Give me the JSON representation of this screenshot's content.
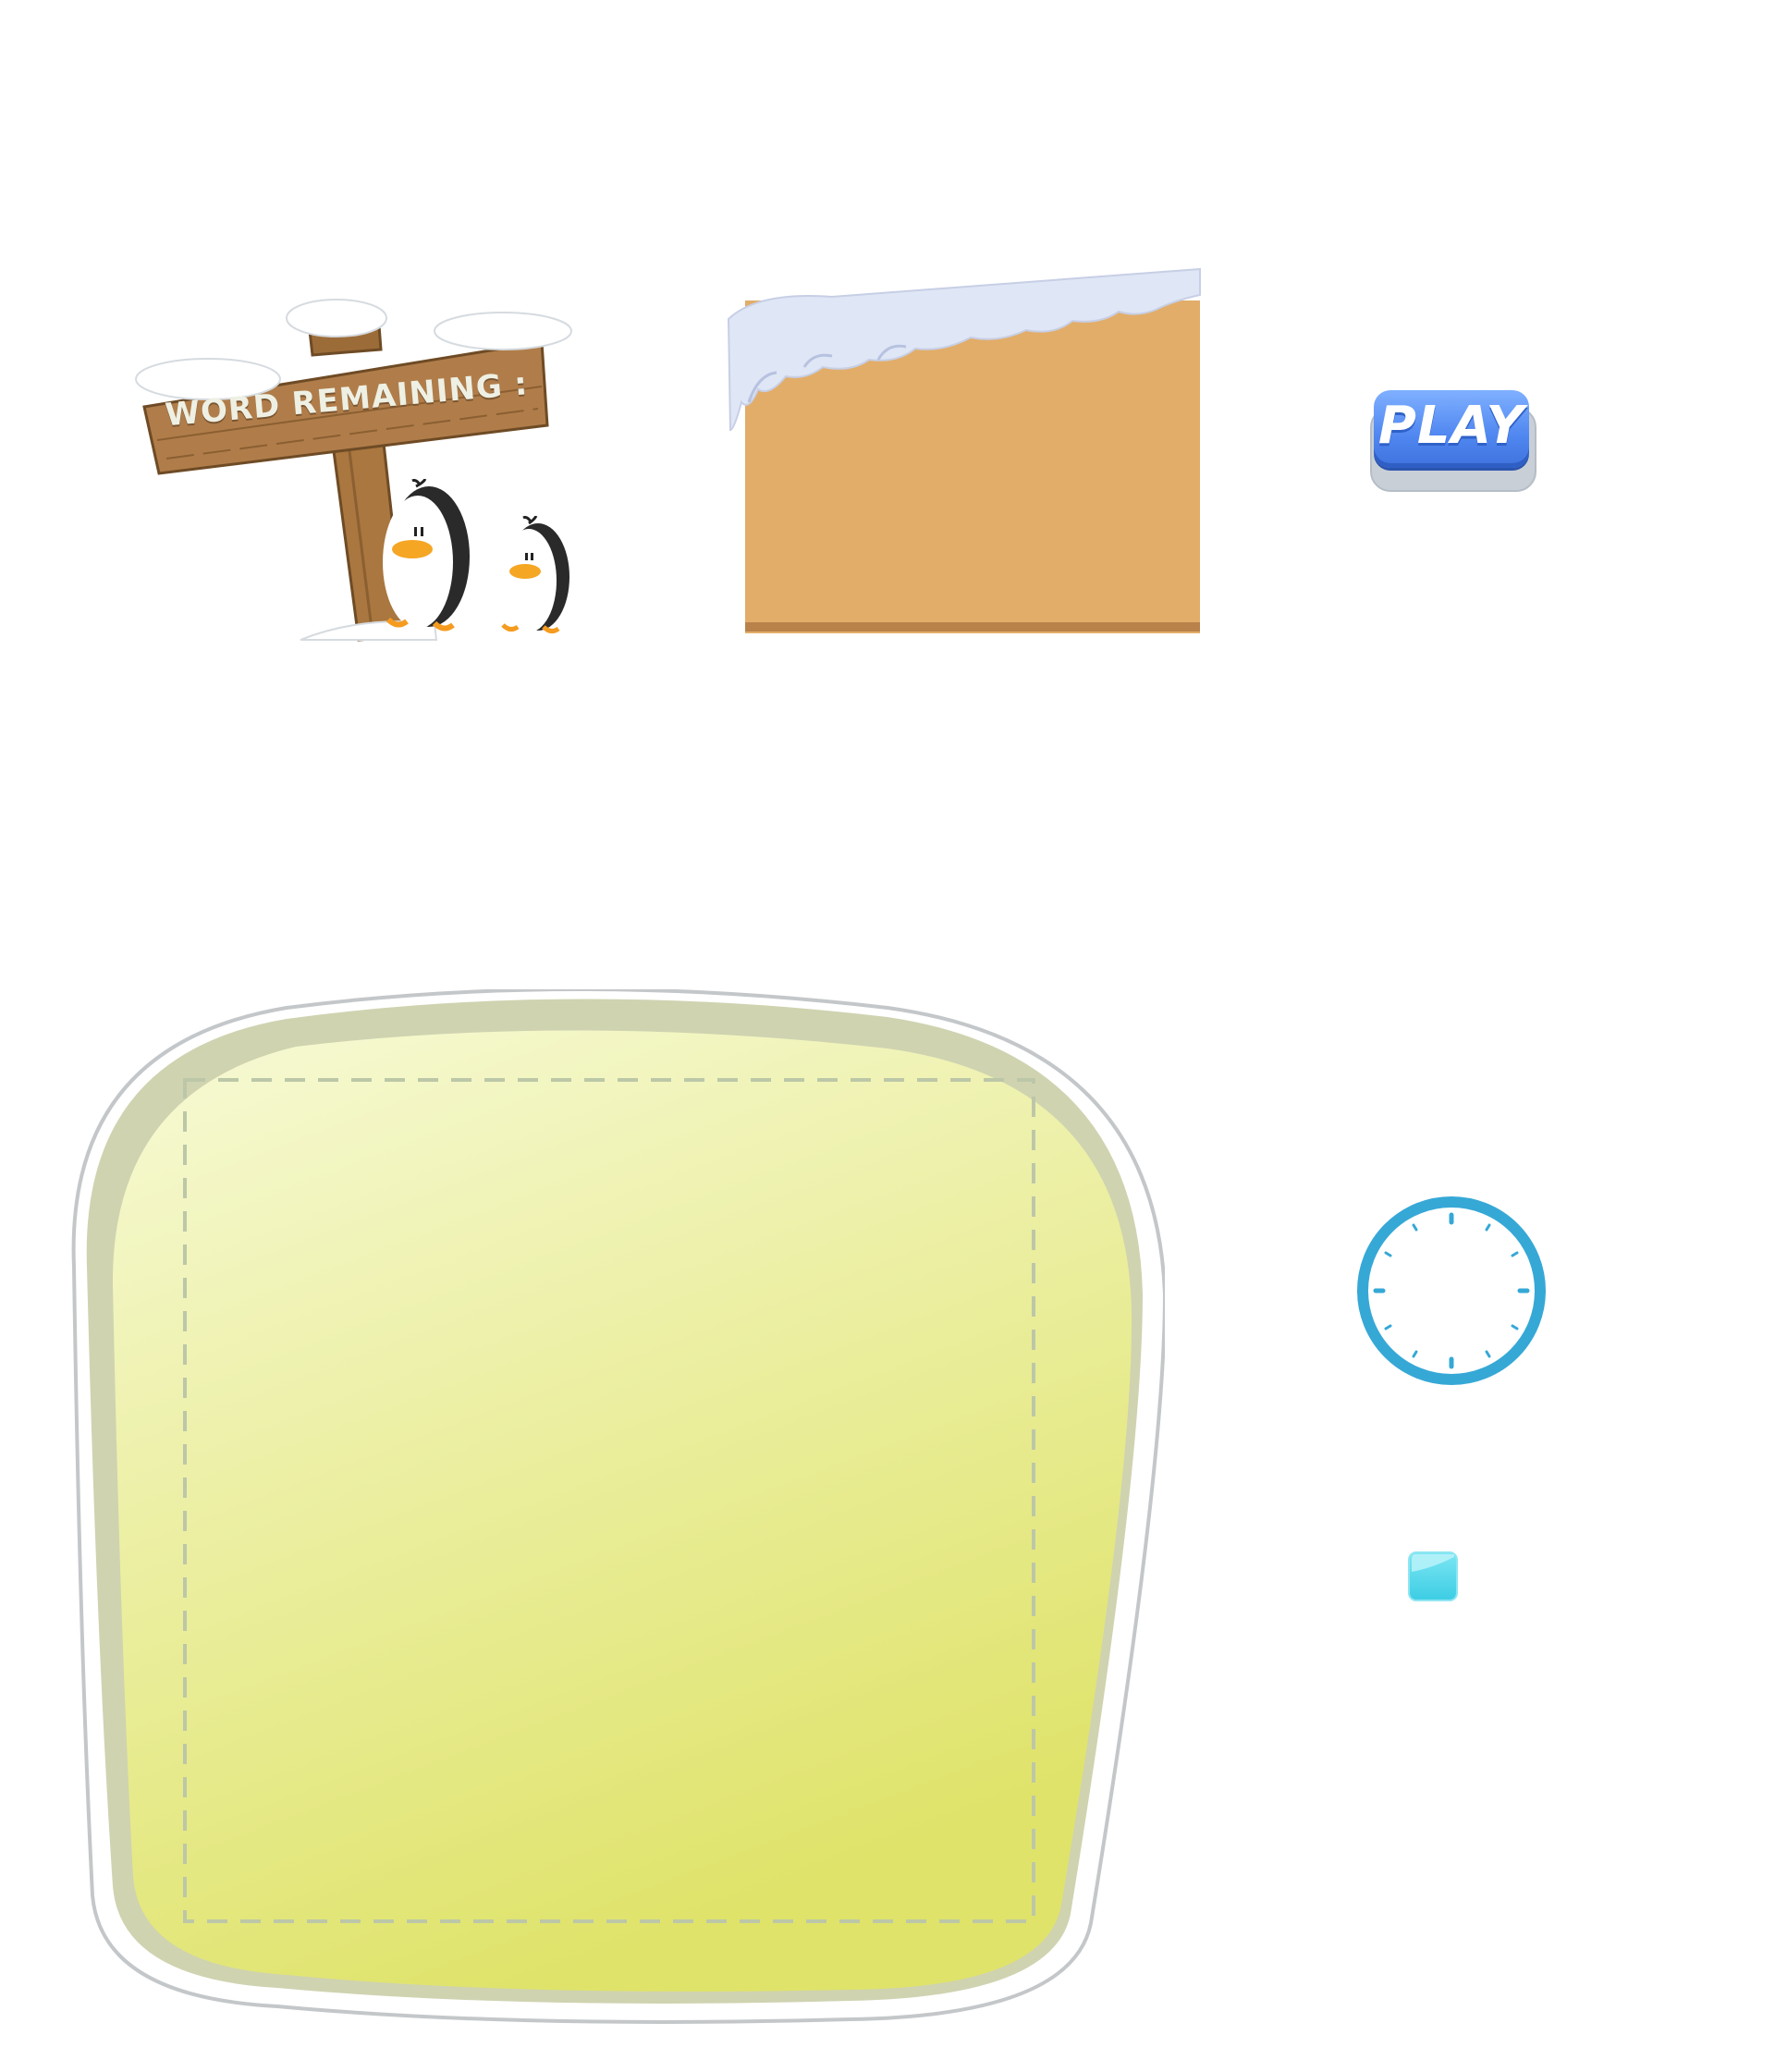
{
  "sign": {
    "label": "WORD REMAINING :",
    "icons": [
      "wooden-sign-icon",
      "penguin-icon",
      "penguin-icon",
      "snow-icon"
    ]
  },
  "panel": {
    "icon": "snowy-wood-panel"
  },
  "play_button": {
    "label": "PLAY",
    "icon": "play-button"
  },
  "board": {
    "icon": "letter-board"
  },
  "clock": {
    "icon": "clock-icon"
  },
  "tile": {
    "icon": "letter-tile"
  },
  "colors": {
    "wood": "#b07d4a",
    "panel": "#e2ad69",
    "board_fill": "#eaef9c",
    "board_rim": "#cfd3b0",
    "play_blue": "#4f86f0",
    "clock_blue": "#36a8d6",
    "tile_cyan": "#4ad8ea"
  }
}
